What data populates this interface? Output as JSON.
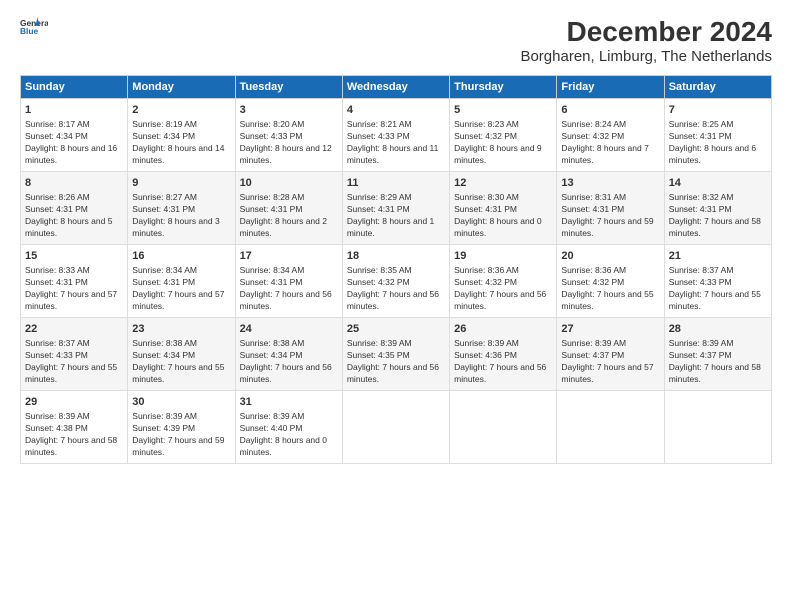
{
  "logo": {
    "line1": "General",
    "line2": "Blue"
  },
  "title": "December 2024",
  "subtitle": "Borgharen, Limburg, The Netherlands",
  "headers": [
    "Sunday",
    "Monday",
    "Tuesday",
    "Wednesday",
    "Thursday",
    "Friday",
    "Saturday"
  ],
  "weeks": [
    [
      {
        "day": "1",
        "sunrise": "8:17 AM",
        "sunset": "4:34 PM",
        "daylight": "8 hours and 16 minutes."
      },
      {
        "day": "2",
        "sunrise": "8:19 AM",
        "sunset": "4:34 PM",
        "daylight": "8 hours and 14 minutes."
      },
      {
        "day": "3",
        "sunrise": "8:20 AM",
        "sunset": "4:33 PM",
        "daylight": "8 hours and 12 minutes."
      },
      {
        "day": "4",
        "sunrise": "8:21 AM",
        "sunset": "4:33 PM",
        "daylight": "8 hours and 11 minutes."
      },
      {
        "day": "5",
        "sunrise": "8:23 AM",
        "sunset": "4:32 PM",
        "daylight": "8 hours and 9 minutes."
      },
      {
        "day": "6",
        "sunrise": "8:24 AM",
        "sunset": "4:32 PM",
        "daylight": "8 hours and 7 minutes."
      },
      {
        "day": "7",
        "sunrise": "8:25 AM",
        "sunset": "4:31 PM",
        "daylight": "8 hours and 6 minutes."
      }
    ],
    [
      {
        "day": "8",
        "sunrise": "8:26 AM",
        "sunset": "4:31 PM",
        "daylight": "8 hours and 5 minutes."
      },
      {
        "day": "9",
        "sunrise": "8:27 AM",
        "sunset": "4:31 PM",
        "daylight": "8 hours and 3 minutes."
      },
      {
        "day": "10",
        "sunrise": "8:28 AM",
        "sunset": "4:31 PM",
        "daylight": "8 hours and 2 minutes."
      },
      {
        "day": "11",
        "sunrise": "8:29 AM",
        "sunset": "4:31 PM",
        "daylight": "8 hours and 1 minute."
      },
      {
        "day": "12",
        "sunrise": "8:30 AM",
        "sunset": "4:31 PM",
        "daylight": "8 hours and 0 minutes."
      },
      {
        "day": "13",
        "sunrise": "8:31 AM",
        "sunset": "4:31 PM",
        "daylight": "7 hours and 59 minutes."
      },
      {
        "day": "14",
        "sunrise": "8:32 AM",
        "sunset": "4:31 PM",
        "daylight": "7 hours and 58 minutes."
      }
    ],
    [
      {
        "day": "15",
        "sunrise": "8:33 AM",
        "sunset": "4:31 PM",
        "daylight": "7 hours and 57 minutes."
      },
      {
        "day": "16",
        "sunrise": "8:34 AM",
        "sunset": "4:31 PM",
        "daylight": "7 hours and 57 minutes."
      },
      {
        "day": "17",
        "sunrise": "8:34 AM",
        "sunset": "4:31 PM",
        "daylight": "7 hours and 56 minutes."
      },
      {
        "day": "18",
        "sunrise": "8:35 AM",
        "sunset": "4:32 PM",
        "daylight": "7 hours and 56 minutes."
      },
      {
        "day": "19",
        "sunrise": "8:36 AM",
        "sunset": "4:32 PM",
        "daylight": "7 hours and 56 minutes."
      },
      {
        "day": "20",
        "sunrise": "8:36 AM",
        "sunset": "4:32 PM",
        "daylight": "7 hours and 55 minutes."
      },
      {
        "day": "21",
        "sunrise": "8:37 AM",
        "sunset": "4:33 PM",
        "daylight": "7 hours and 55 minutes."
      }
    ],
    [
      {
        "day": "22",
        "sunrise": "8:37 AM",
        "sunset": "4:33 PM",
        "daylight": "7 hours and 55 minutes."
      },
      {
        "day": "23",
        "sunrise": "8:38 AM",
        "sunset": "4:34 PM",
        "daylight": "7 hours and 55 minutes."
      },
      {
        "day": "24",
        "sunrise": "8:38 AM",
        "sunset": "4:34 PM",
        "daylight": "7 hours and 56 minutes."
      },
      {
        "day": "25",
        "sunrise": "8:39 AM",
        "sunset": "4:35 PM",
        "daylight": "7 hours and 56 minutes."
      },
      {
        "day": "26",
        "sunrise": "8:39 AM",
        "sunset": "4:36 PM",
        "daylight": "7 hours and 56 minutes."
      },
      {
        "day": "27",
        "sunrise": "8:39 AM",
        "sunset": "4:37 PM",
        "daylight": "7 hours and 57 minutes."
      },
      {
        "day": "28",
        "sunrise": "8:39 AM",
        "sunset": "4:37 PM",
        "daylight": "7 hours and 58 minutes."
      }
    ],
    [
      {
        "day": "29",
        "sunrise": "8:39 AM",
        "sunset": "4:38 PM",
        "daylight": "7 hours and 58 minutes."
      },
      {
        "day": "30",
        "sunrise": "8:39 AM",
        "sunset": "4:39 PM",
        "daylight": "7 hours and 59 minutes."
      },
      {
        "day": "31",
        "sunrise": "8:39 AM",
        "sunset": "4:40 PM",
        "daylight": "8 hours and 0 minutes."
      },
      null,
      null,
      null,
      null
    ]
  ],
  "labels": {
    "sunrise": "Sunrise:",
    "sunset": "Sunset:",
    "daylight": "Daylight:"
  }
}
